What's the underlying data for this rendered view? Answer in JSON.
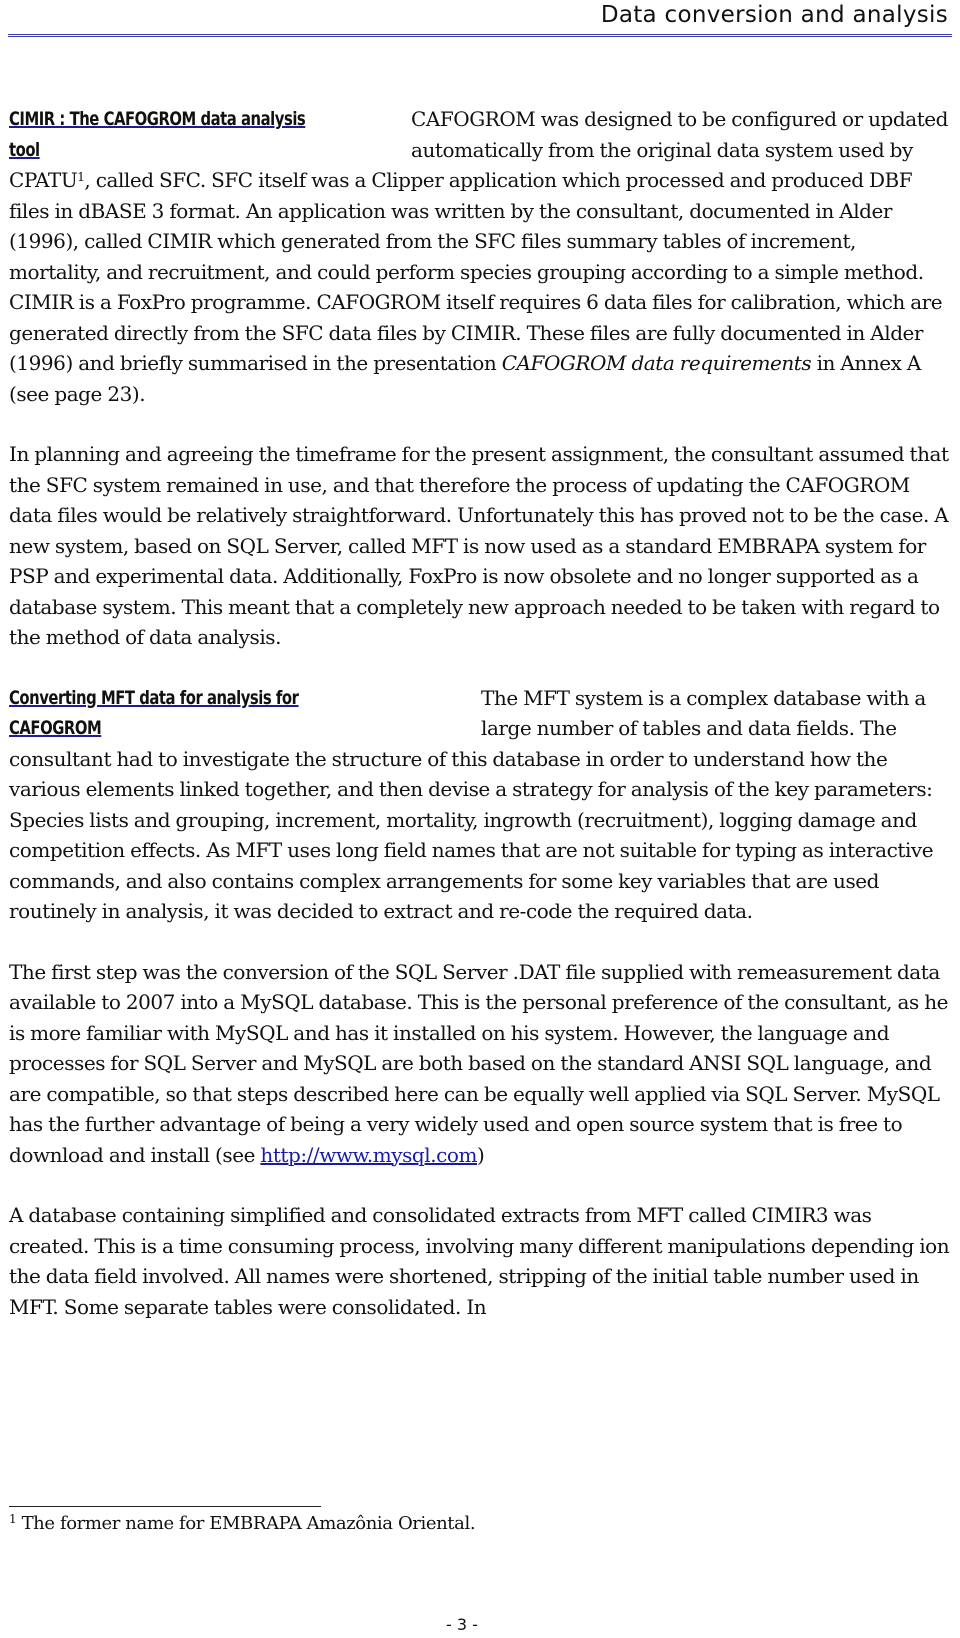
{
  "header": {
    "title": "Data conversion and analysis"
  },
  "sections": [
    {
      "heading": "CIMIR : The CAFOGROM data analysis tool",
      "paragraphs": [
        {
          "lead": "CAFOGROM was designed to be configured or updated automatically from the original data system used by CPATU",
          "footnote_ref": "1",
          "text_a": ", called SFC.  SFC itself was a Clipper application which processed and produced DBF files in dBASE 3 format.  An application was written by the consultant, documented in Alder (1996), called CIMIR which generated from the SFC files summary tables of increment, mortality, and recruitment, and could perform species grouping according to a simple method.  CIMIR is a FoxPro programme.  CAFOGROM itself requires 6 data files for calibration, which are generated directly from the SFC data files by CIMIR.  These files are fully documented in Alder (1996) and briefly summarised in the presentation ",
          "emphasis": "CAFOGROM data requirements",
          "text_b": " in Annex A (see page 23)."
        },
        {
          "text": "In planning and agreeing the timeframe for the present assignment, the consultant assumed that the SFC system remained in use, and that therefore the process of updating the CAFOGROM data files would be relatively straightforward.  Unfortunately this has proved not to be the case.  A new system, based on SQL Server, called MFT is now used as a standard EMBRAPA system for PSP and experimental data.  Additionally, FoxPro is now obsolete and no longer supported as a database system.  This meant that a completely new approach needed to be taken with regard to the method of data analysis."
        }
      ]
    },
    {
      "heading": "Converting MFT data for analysis for CAFOGROM",
      "paragraphs": [
        {
          "text": "The MFT system is a complex database with a large number of tables and data fields.  The consultant had to investigate the structure of this database in order to understand how the various elements linked together, and then devise a strategy for analysis of the key parameters:  Species lists and grouping, increment, mortality, ingrowth (recruitment), logging damage and competition effects.  As MFT uses long field names that are not suitable for typing as interactive commands, and also contains complex arrangements for some key variables that are used routinely in analysis, it was decided to extract and re-code the required data."
        },
        {
          "text_a": "The first step was the conversion of the SQL Server .DAT file supplied with remeasurement data available to 2007 into a MySQL database.  This is the personal preference of the consultant, as he is more familiar with MySQL and has it installed on his system.  However, the language and processes for SQL Server and MySQL are both based on the standard ANSI SQL language, and are compatible, so that steps described here can be equally well applied via SQL Server.  MySQL has the further advantage of being a very widely used and open source system that is free to download and install (see ",
          "link": "http://www.mysql.com",
          "text_b": ")"
        },
        {
          "text": "A database containing simplified and consolidated extracts from MFT called CIMIR3 was created.  This is a time consuming process, involving many different manipulations depending ion the data field involved.  All names were shortened, stripping of the initial table number used in MFT.  Some separate tables were consolidated.  In"
        }
      ]
    }
  ],
  "footnote": {
    "marker": "1",
    "text": " The former name for EMBRAPA Amazônia Oriental."
  },
  "page_number": "- 3 -"
}
